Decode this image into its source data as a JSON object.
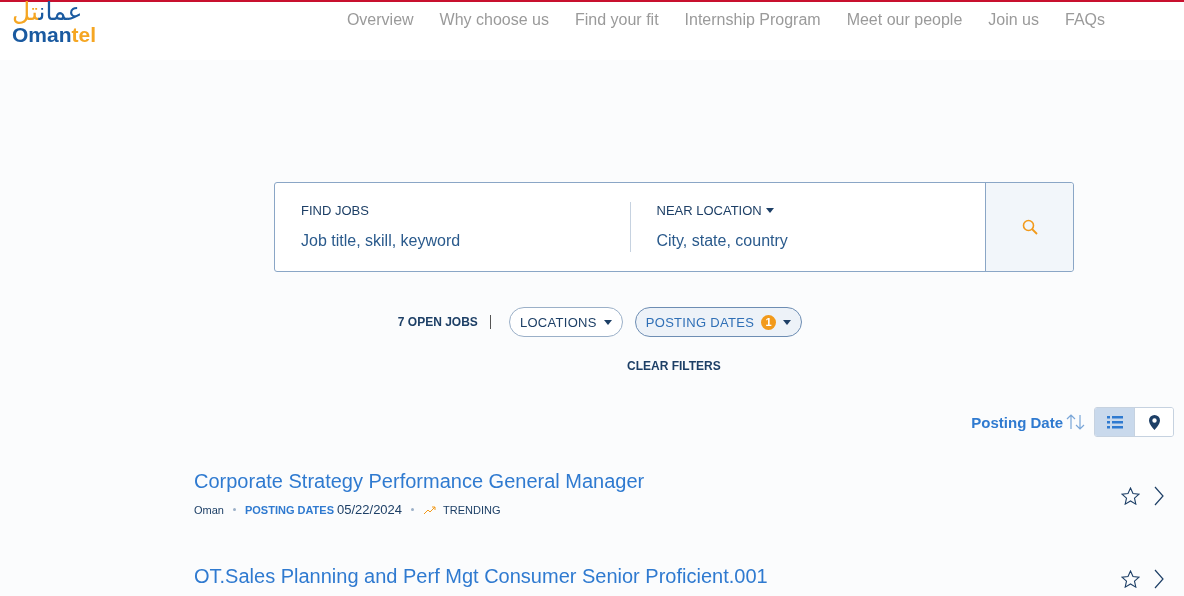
{
  "logo": {
    "arabic_main": "عمان",
    "arabic_accent": "تل",
    "main": "Oman",
    "accent": "tel"
  },
  "nav": [
    {
      "label": "Overview"
    },
    {
      "label": "Why choose us"
    },
    {
      "label": "Find your fit"
    },
    {
      "label": "Internship Program"
    },
    {
      "label": "Meet our people"
    },
    {
      "label": "Join us"
    },
    {
      "label": "FAQs"
    }
  ],
  "search": {
    "jobs_label": "FIND JOBS",
    "jobs_placeholder": "Job title, skill, keyword",
    "location_label": "NEAR LOCATION",
    "location_placeholder": "City, state, country"
  },
  "filters": {
    "count": "7 OPEN JOBS",
    "chips": [
      {
        "label": "LOCATIONS",
        "active": false
      },
      {
        "label": "POSTING DATES",
        "active": true,
        "badge": "1"
      }
    ],
    "clear": "CLEAR FILTERS"
  },
  "sort": {
    "label": "Posting Date",
    "views": [
      {
        "kind": "list",
        "selected": true
      },
      {
        "kind": "map",
        "selected": false
      }
    ]
  },
  "jobs": [
    {
      "title": "Corporate Strategy Performance General Manager",
      "location": "Oman",
      "date_label": "POSTING DATES",
      "date": "05/22/2024",
      "tag": "TRENDING"
    },
    {
      "title": "OT.Sales Planning and Perf Mgt Consumer Senior Proficient.001"
    }
  ]
}
